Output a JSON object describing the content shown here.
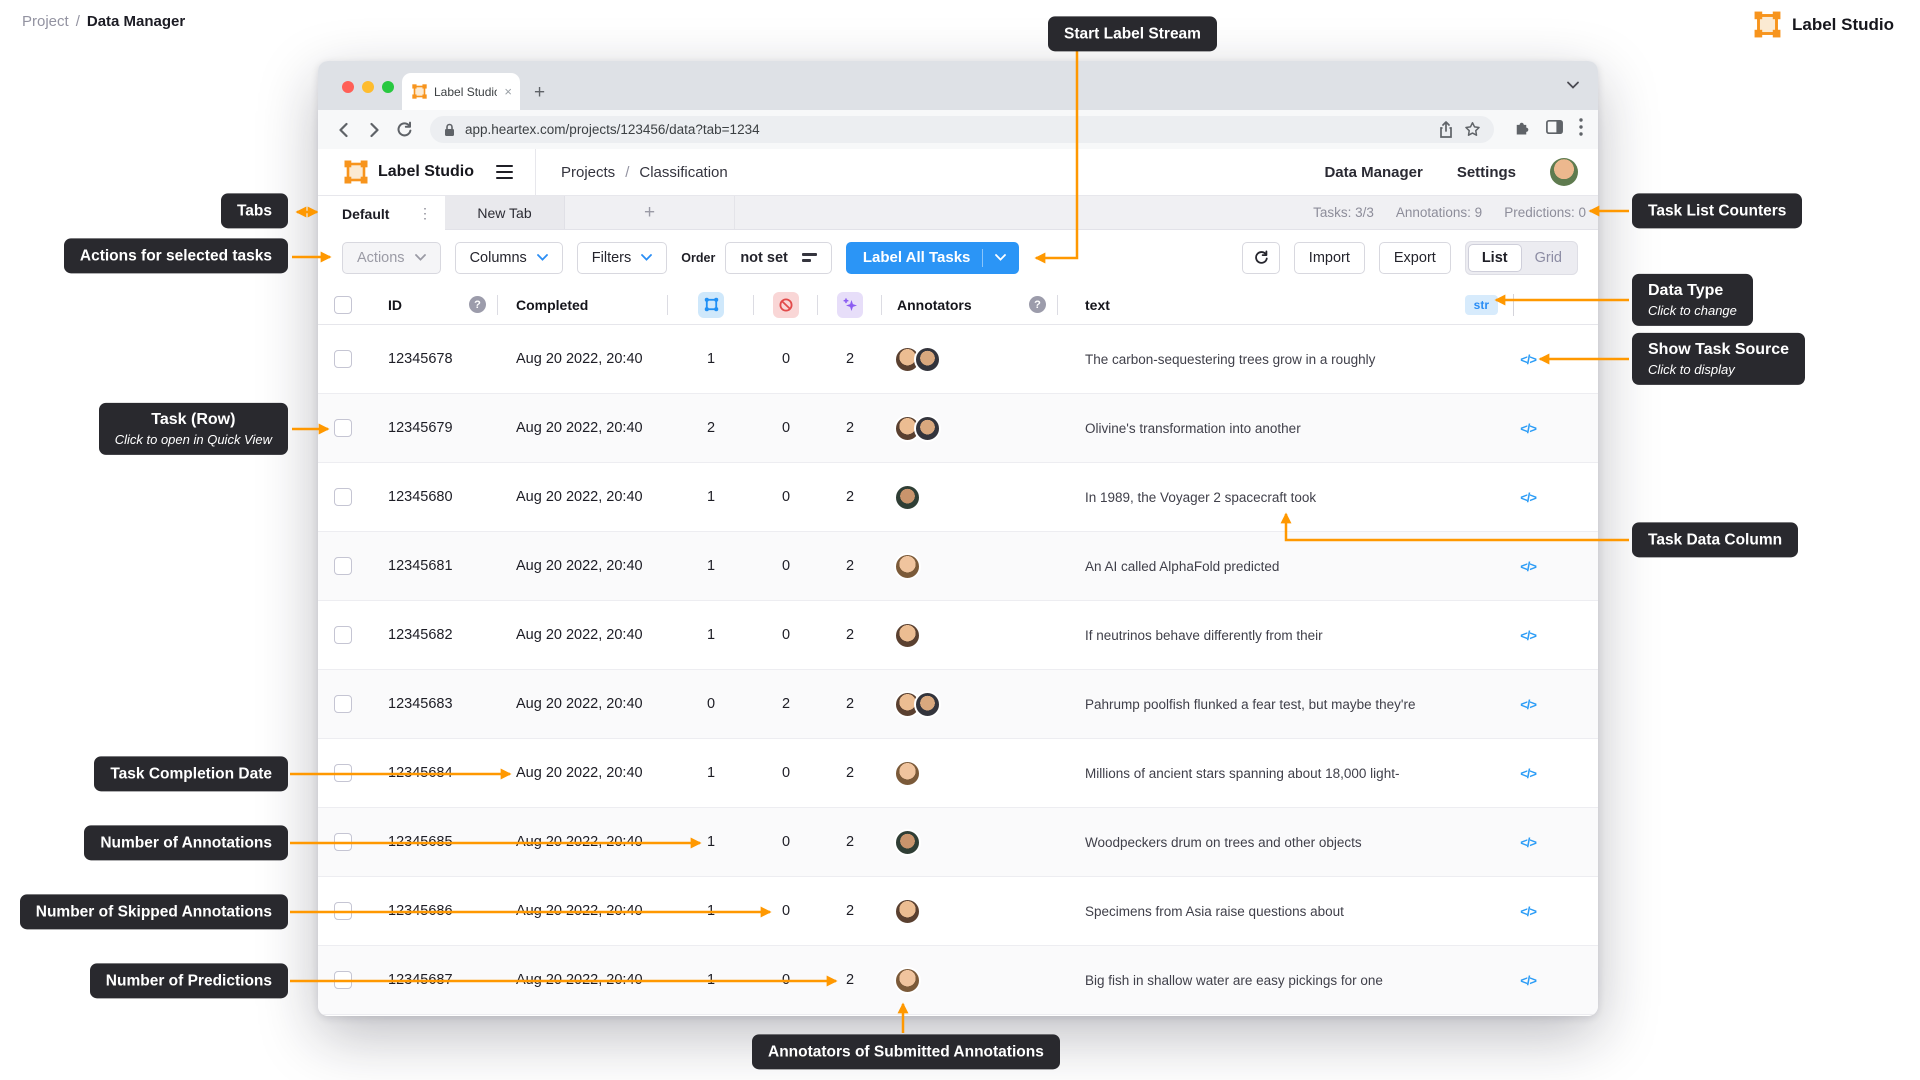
{
  "page": {
    "breadcrumb": {
      "project": "Project",
      "separator": "/",
      "current": "Data Manager"
    },
    "brand": "Label Studio"
  },
  "browser": {
    "tab_title": "Label Studio",
    "url": "app.heartex.com/projects/123456/data?tab=1234"
  },
  "app": {
    "header": {
      "brand": "Label Studio",
      "breadcrumb": {
        "projects": "Projects",
        "separator": "/",
        "current": "Classification"
      },
      "nav_data_manager": "Data Manager",
      "nav_settings": "Settings"
    },
    "tabs": {
      "active": "Default",
      "second": "New Tab"
    },
    "counters": {
      "tasks": "Tasks: 3/3",
      "annotations": "Annotations: 9",
      "predictions": "Predictions: 0"
    },
    "toolbar": {
      "actions": "Actions",
      "columns": "Columns",
      "filters": "Filters",
      "order_label": "Order",
      "order_value": "not set",
      "label_all_tasks": "Label All Tasks",
      "import": "Import",
      "export": "Export",
      "view_list": "List",
      "view_grid": "Grid"
    },
    "table": {
      "header": {
        "id": "ID",
        "completed": "Completed",
        "annotators": "Annotators",
        "text": "text",
        "data_type": "str"
      },
      "rows": [
        {
          "id": "12345678",
          "completed": "Aug 20 2022, 20:40",
          "annotations": "1",
          "skipped": "0",
          "predictions": "2",
          "annotators": [
            "avatar-female-1",
            "avatar-male-1"
          ],
          "text": "The carbon-sequestering trees grow in a roughly"
        },
        {
          "id": "12345679",
          "completed": "Aug 20 2022, 20:40",
          "annotations": "2",
          "skipped": "0",
          "predictions": "2",
          "annotators": [
            "avatar-female-1",
            "avatar-male-1"
          ],
          "text": "Olivine's transformation into another"
        },
        {
          "id": "12345680",
          "completed": "Aug 20 2022, 20:40",
          "annotations": "1",
          "skipped": "0",
          "predictions": "2",
          "annotators": [
            "avatar-male-2"
          ],
          "text": "In 1989, the Voyager 2 spacecraft took"
        },
        {
          "id": "12345681",
          "completed": "Aug 20 2022, 20:40",
          "annotations": "1",
          "skipped": "0",
          "predictions": "2",
          "annotators": [
            "avatar-female-2"
          ],
          "text": "An AI called AlphaFold predicted"
        },
        {
          "id": "12345682",
          "completed": "Aug 20 2022, 20:40",
          "annotations": "1",
          "skipped": "0",
          "predictions": "2",
          "annotators": [
            "avatar-female-1"
          ],
          "text": "If neutrinos behave differently from their"
        },
        {
          "id": "12345683",
          "completed": "Aug 20 2022, 20:40",
          "annotations": "0",
          "skipped": "2",
          "predictions": "2",
          "annotators": [
            "avatar-female-1",
            "avatar-male-1"
          ],
          "text": "Pahrump poolfish flunked a fear test, but maybe they're"
        },
        {
          "id": "12345684",
          "completed": "Aug 20 2022, 20:40",
          "annotations": "1",
          "skipped": "0",
          "predictions": "2",
          "annotators": [
            "avatar-female-2"
          ],
          "text": "Millions of ancient stars spanning about 18,000 light-"
        },
        {
          "id": "12345685",
          "completed": "Aug 20 2022, 20:40",
          "annotations": "1",
          "skipped": "0",
          "predictions": "2",
          "annotators": [
            "avatar-male-2"
          ],
          "text": "Woodpeckers drum on trees and other objects"
        },
        {
          "id": "12345686",
          "completed": "Aug 20 2022, 20:40",
          "annotations": "1",
          "skipped": "0",
          "predictions": "2",
          "annotators": [
            "avatar-female-1"
          ],
          "text": "Specimens from Asia raise questions about"
        },
        {
          "id": "12345687",
          "completed": "Aug 20 2022, 20:40",
          "annotations": "1",
          "skipped": "0",
          "predictions": "2",
          "annotators": [
            "avatar-female-2"
          ],
          "text": "Big fish in shallow water are easy pickings for one"
        }
      ]
    }
  },
  "callouts": {
    "start_label_stream": {
      "title": "Start Label Stream"
    },
    "tabs": {
      "title": "Tabs"
    },
    "actions": {
      "title": "Actions for selected tasks"
    },
    "task_row": {
      "title": "Task (Row)",
      "subtitle": "Click to open in Quick View"
    },
    "completion_date": {
      "title": "Task Completion Date"
    },
    "num_annotations": {
      "title": "Number of Annotations"
    },
    "num_skipped": {
      "title": "Number of Skipped Annotations"
    },
    "num_predictions": {
      "title": "Number of Predictions"
    },
    "annotators_submitted": {
      "title": "Annotators of Submitted Annotations"
    },
    "task_list_counters": {
      "title": "Task List Counters"
    },
    "data_type": {
      "title": "Data Type",
      "subtitle": "Click to change"
    },
    "show_task_source": {
      "title": "Show Task Source",
      "subtitle": "Click to display"
    },
    "task_data_column": {
      "title": "Task Data Column"
    }
  },
  "icons": {
    "code": "</>",
    "kebab_vertical": "⋮",
    "plus": "+",
    "close": "×",
    "question": "?"
  },
  "colors": {
    "accent_orange": "#FF9800",
    "primary_blue": "#2B95F6",
    "callout_bg": "#29292E",
    "str_badge_bg": "#D7EBFC",
    "str_badge_text": "#2B8EF5",
    "annotations_icon": "#2090F5",
    "skipped_icon": "#E24A4A",
    "predictions_icon": "#8B5CF2",
    "traffic_red": "#FF5F57",
    "traffic_yellow": "#FEBC2E",
    "traffic_green": "#28C840"
  }
}
